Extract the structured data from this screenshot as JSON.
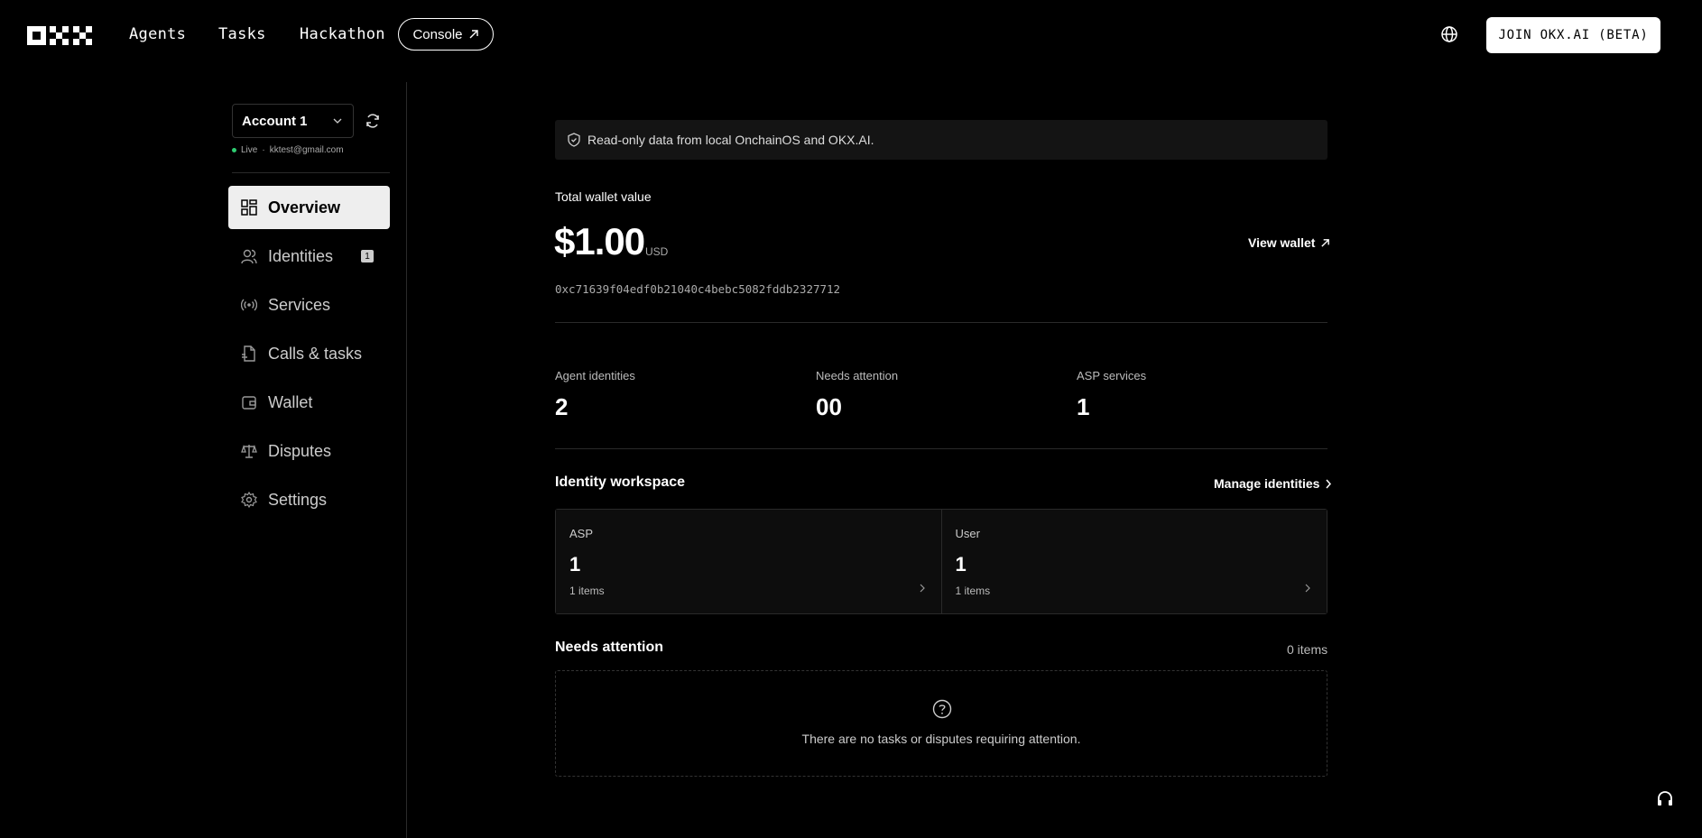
{
  "nav": {
    "links": [
      "Agents",
      "Tasks",
      "Hackathon"
    ],
    "console_label": "Console",
    "join_label": "JOIN OKX.AI (BETA)"
  },
  "sidebar": {
    "account_label": "Account 1",
    "status": "Live",
    "email": "kktest@gmail.com",
    "items": [
      {
        "label": "Overview",
        "icon": "grid-icon",
        "active": true
      },
      {
        "label": "Identities",
        "icon": "users-icon",
        "badge": "1"
      },
      {
        "label": "Services",
        "icon": "broadcast-icon"
      },
      {
        "label": "Calls & tasks",
        "icon": "file-icon"
      },
      {
        "label": "Wallet",
        "icon": "wallet-icon"
      },
      {
        "label": "Disputes",
        "icon": "scale-icon"
      },
      {
        "label": "Settings",
        "icon": "gear-icon"
      }
    ]
  },
  "main": {
    "notice": "Read-only data from local OnchainOS and OKX.AI.",
    "wallet_label": "Total wallet value",
    "wallet_value": "$1.00",
    "wallet_currency": "USD",
    "view_wallet_label": "View wallet",
    "address": "0xc71639f04edf0b21040c4bebc5082fddb2327712",
    "stats": [
      {
        "label": "Agent identities",
        "value": "2"
      },
      {
        "label": "Needs attention",
        "value": "00"
      },
      {
        "label": "ASP services",
        "value": "1"
      }
    ],
    "workspace": {
      "title": "Identity workspace",
      "manage_label": "Manage identities",
      "cells": [
        {
          "label": "ASP",
          "value": "1",
          "sub": "1 items"
        },
        {
          "label": "User",
          "value": "1",
          "sub": "1 items"
        }
      ]
    },
    "attention": {
      "title": "Needs attention",
      "count": "0 items",
      "empty_text": "There are no tasks or disputes requiring attention."
    }
  },
  "colors": {
    "background": "#000000",
    "active_item_bg": "#eeeeee",
    "live_dot": "#2ecc71"
  }
}
